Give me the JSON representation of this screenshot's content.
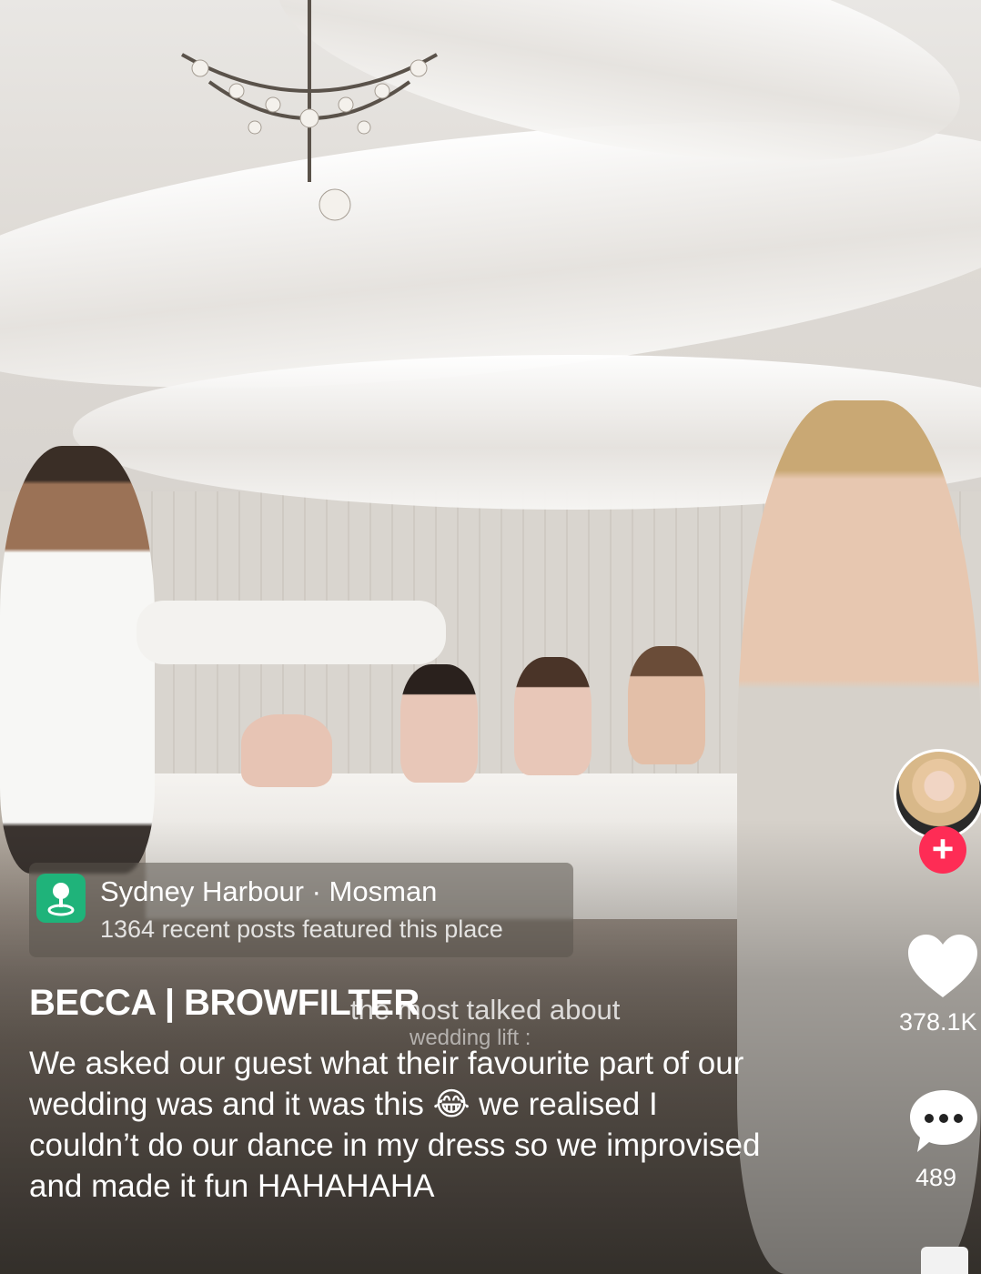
{
  "location": {
    "name": "Sydney Harbour · Mosman",
    "subtitle": "1364 recent posts featured this place",
    "icon": "location-pin-icon"
  },
  "post": {
    "username": "BECCA | BROWFILTER",
    "caption": "We asked our guest what their favourite part of our wedding was and it was this 😂 we realised I couldn’t do our dance in my dress so we improvised and made it fun HAHAHAHA",
    "video_overlay_line1": "the most talked about",
    "video_overlay_line2": "wedding lift :"
  },
  "actions": {
    "follow_label": "+",
    "likes": "378.1K",
    "comments": "489",
    "like_icon": "heart-icon",
    "comment_icon": "comment-bubble-icon",
    "accent_color": "#fe2c55"
  }
}
